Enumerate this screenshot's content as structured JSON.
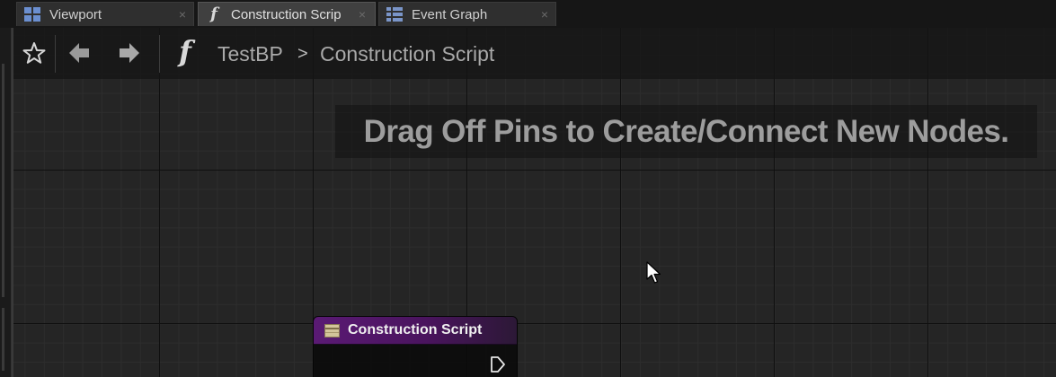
{
  "tabs": [
    {
      "label": "Viewport",
      "icon": "viewport-grid-icon",
      "close": "×",
      "active": false
    },
    {
      "label": "Construction Scrip",
      "icon": "function-icon",
      "close": "×",
      "active": true
    },
    {
      "label": "Event Graph",
      "icon": "event-graph-icon",
      "close": "×",
      "active": false
    }
  ],
  "toolbar": {
    "favorite_icon": "star-icon",
    "back_icon": "arrow-left-icon",
    "forward_icon": "arrow-right-icon",
    "function_glyph": "f",
    "breadcrumb": {
      "parent": "TestBP",
      "separator": ">",
      "current": "Construction Script"
    }
  },
  "graph": {
    "hint": "Drag Off Pins to Create/Connect New Nodes."
  },
  "node": {
    "title": "Construction Script",
    "icon": "construction-script-icon",
    "header_color": "#5a1a74",
    "exec_pin_icon": "exec-pin-icon"
  },
  "colors": {
    "graph_background": "#252525",
    "toolbar_background": "#141414",
    "active_tab": "#404040"
  }
}
